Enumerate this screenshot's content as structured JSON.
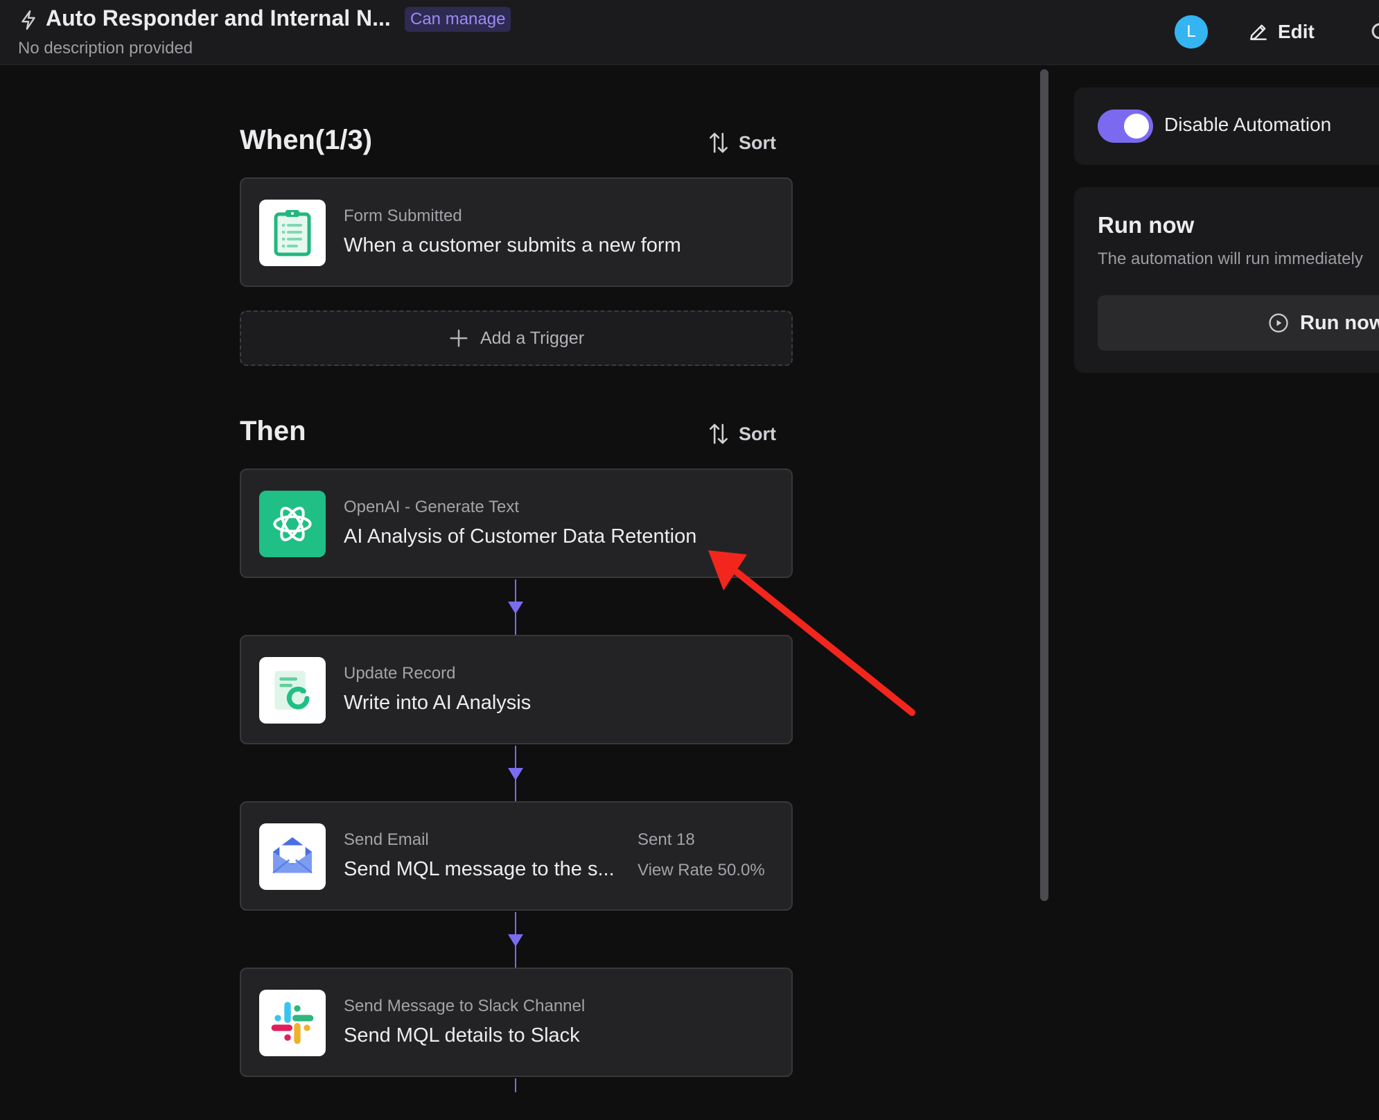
{
  "header": {
    "icon": "bolt-icon",
    "title": "Auto Responder and Internal N...",
    "badge": "Can manage",
    "description": "No description provided",
    "avatar_initial": "L",
    "edit_label": "Edit"
  },
  "when": {
    "title": "When(1/3)",
    "sort_label": "Sort",
    "trigger": {
      "icon": "clipboard-icon",
      "label": "Form Submitted",
      "value": "When a customer submits a new form"
    },
    "add_trigger_label": "Add a Trigger"
  },
  "then": {
    "title": "Then",
    "sort_label": "Sort",
    "actions": [
      {
        "icon": "openai-icon",
        "label": "OpenAI - Generate Text",
        "value": "AI Analysis of Customer Data Retention"
      },
      {
        "icon": "update-record-icon",
        "label": "Update Record",
        "value": "Write into AI Analysis"
      },
      {
        "icon": "email-icon",
        "label": "Send Email",
        "value": "Send MQL message to the s...",
        "stat_sent": "Sent 18",
        "stat_view_rate": "View Rate 50.0%"
      },
      {
        "icon": "slack-icon",
        "label": "Send Message to Slack Channel",
        "value": "Send MQL details to Slack"
      }
    ]
  },
  "side_panel": {
    "toggle_label": "Disable Automation",
    "toggle_on": true,
    "run_title": "Run now",
    "run_description": "The automation will run immediately",
    "run_button_label": "Run now"
  },
  "colors": {
    "accent": "#7b6af0",
    "annotation_arrow": "#f2261d",
    "openai_green": "#1fbf86"
  }
}
